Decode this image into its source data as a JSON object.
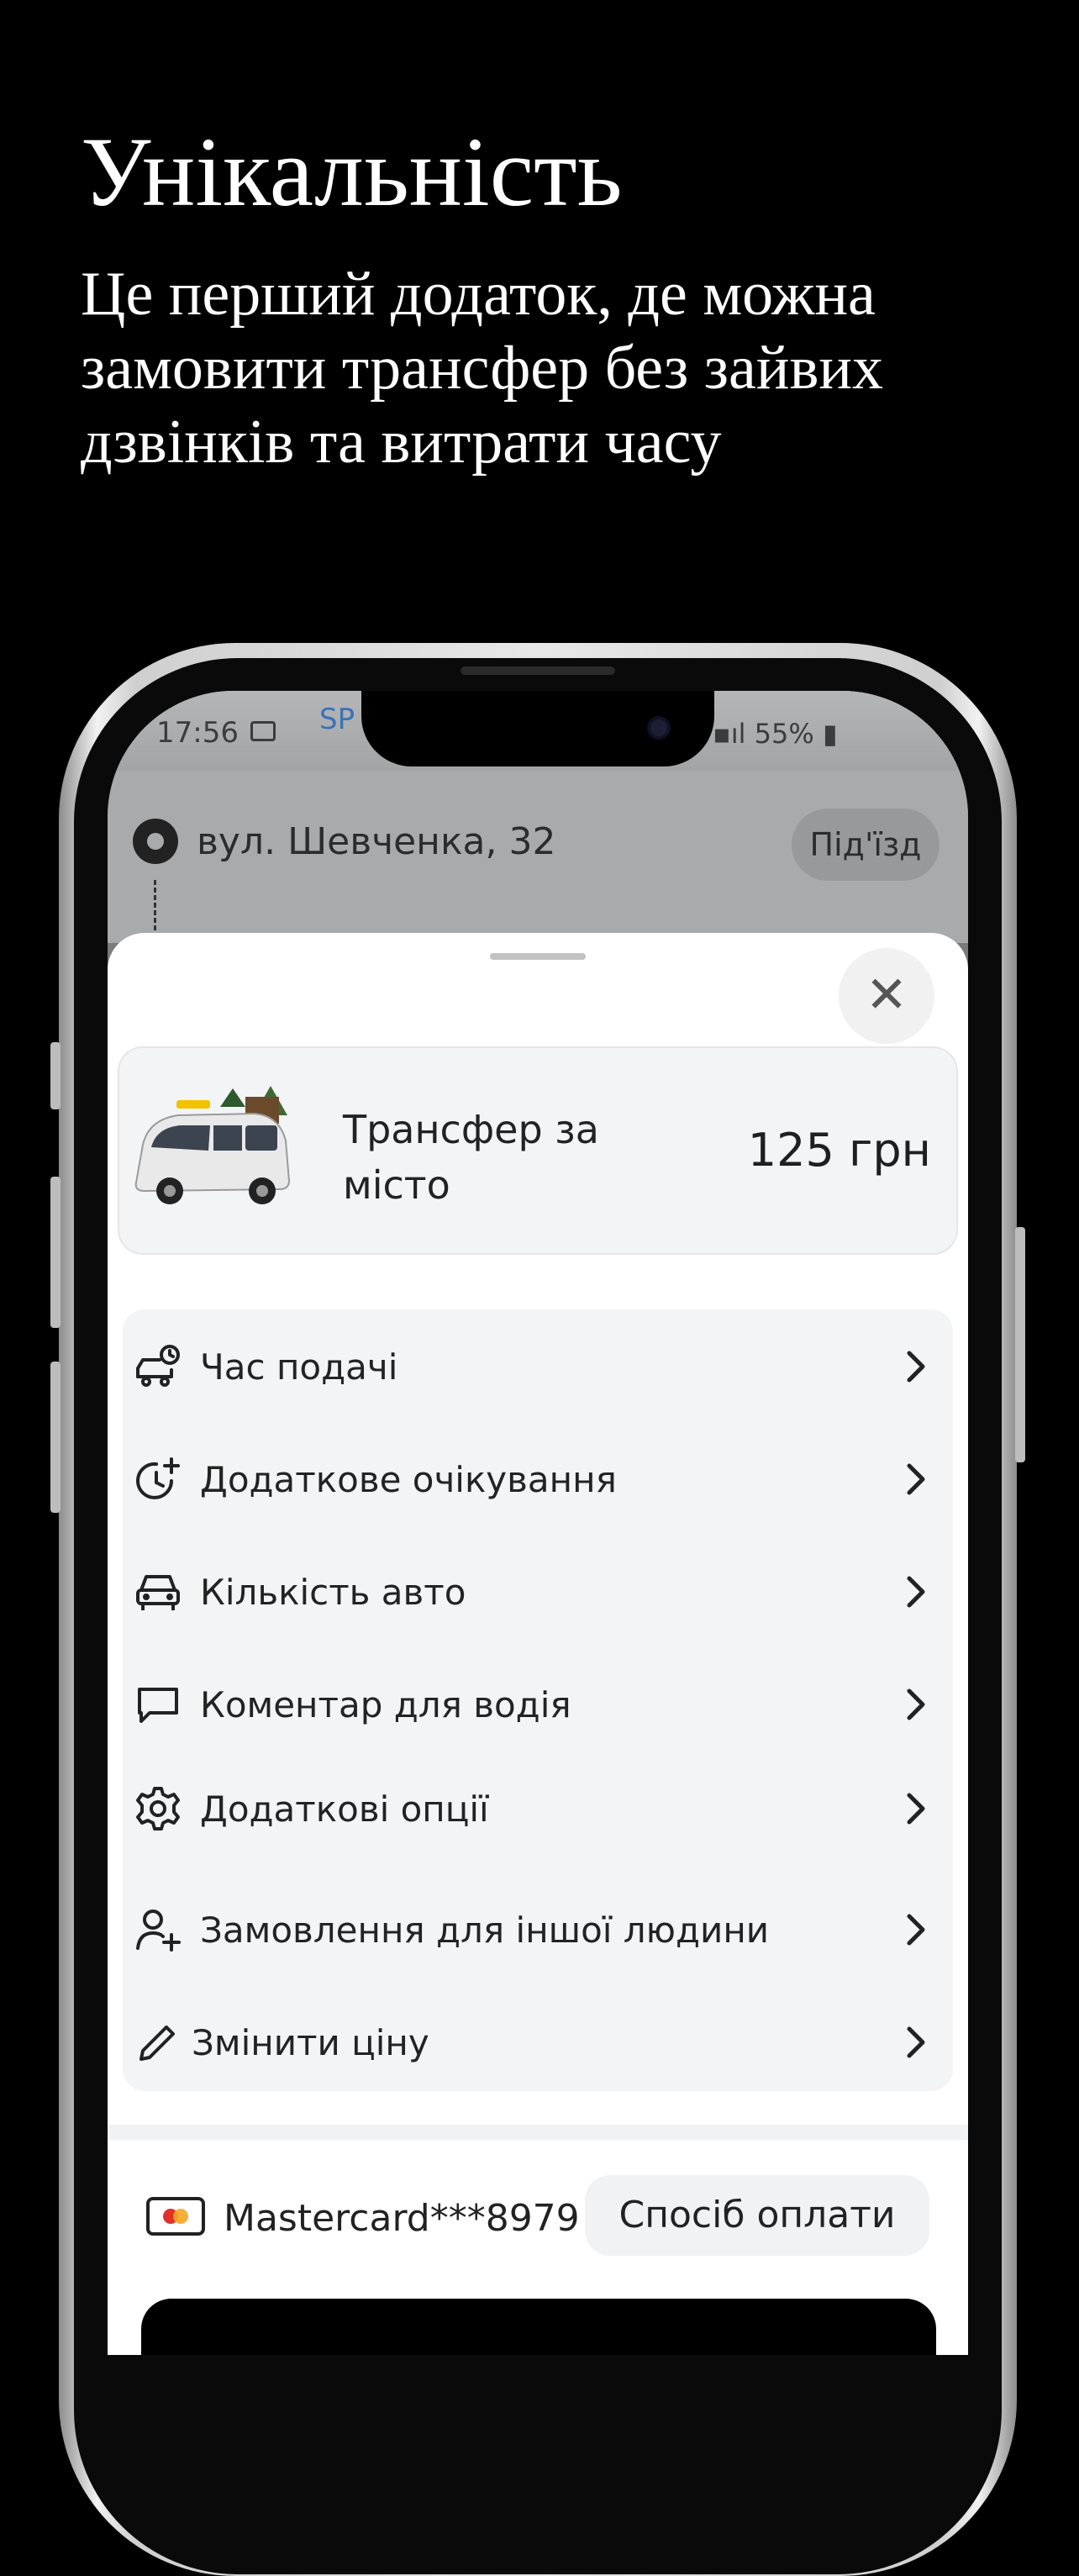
{
  "header": {
    "title": "Унікальність",
    "subtitle": "Це перший додаток, де можна замовити трансфер без зайвих дзвінків та витрати часу"
  },
  "status_bar": {
    "time": "17:56",
    "signal_text": "55%",
    "map_label": "SP"
  },
  "route": {
    "pickup_address": "вул. Шевченка, 32",
    "entrance_label": "Під'їзд"
  },
  "tariff": {
    "name": "Трансфер за місто",
    "price": "125 грн"
  },
  "options": [
    {
      "label": "Час подачі",
      "icon": "car-clock-icon"
    },
    {
      "label": "Додаткове очікування",
      "icon": "clock-plus-icon"
    },
    {
      "label": "Кількість авто",
      "icon": "car-icon"
    },
    {
      "label": "Коментар для водія",
      "icon": "comment-icon"
    },
    {
      "label": "Додаткові опції",
      "icon": "gear-icon"
    },
    {
      "label": "Замовлення для іншої людини",
      "icon": "user-plus-icon"
    },
    {
      "label": "Змінити ціну",
      "icon": "pencil-icon"
    }
  ],
  "payment": {
    "card": "Mastercard***8979",
    "method_button": "Спосіб оплати"
  }
}
